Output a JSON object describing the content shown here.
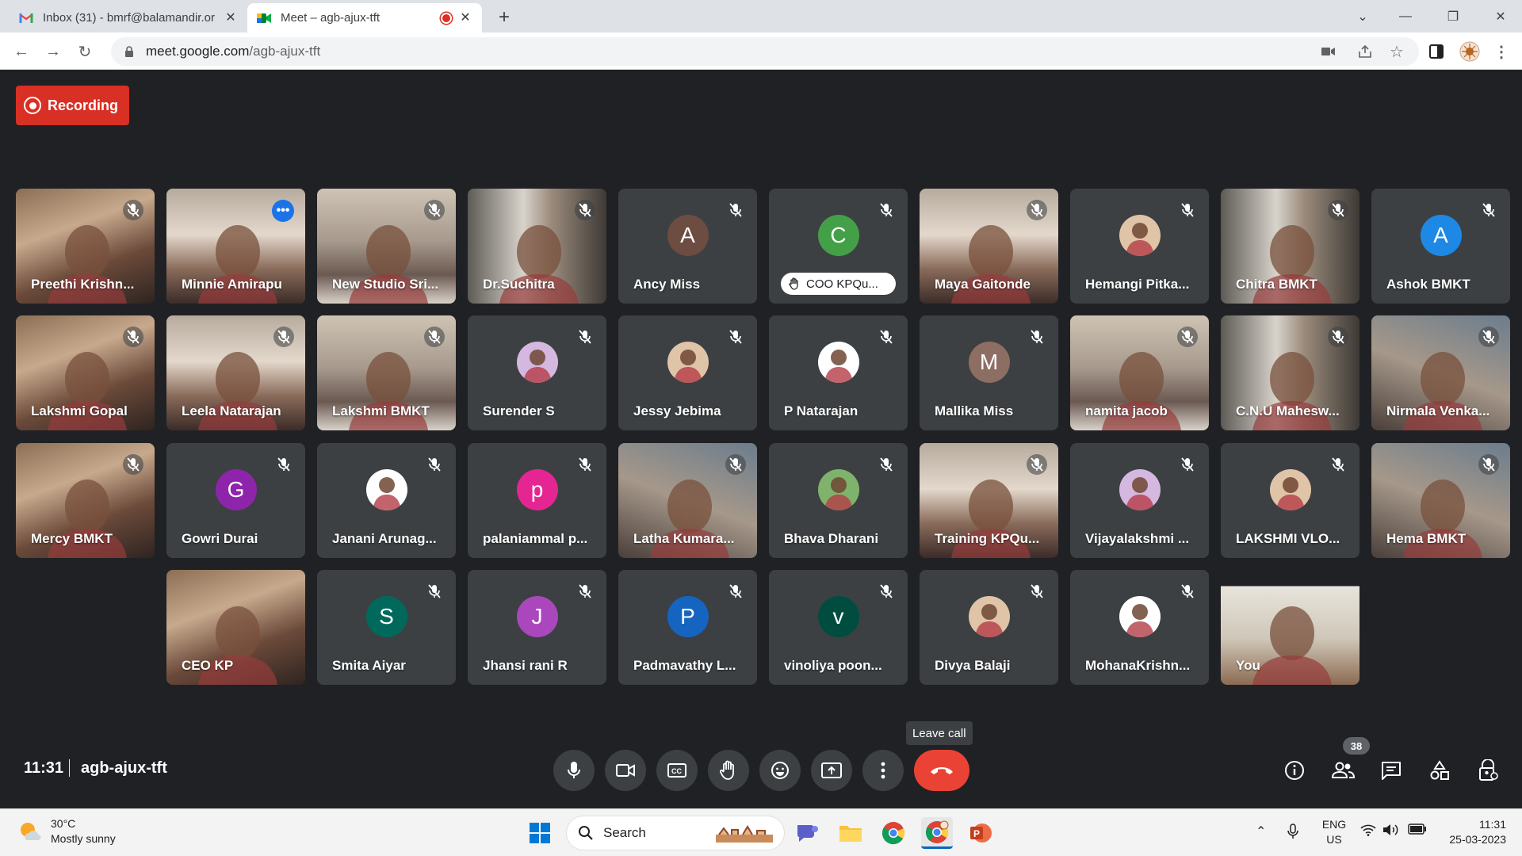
{
  "browser": {
    "tabs": [
      {
        "title": "Inbox (31) - bmrf@balamandir.or",
        "active": false,
        "favicon": "gmail-icon"
      },
      {
        "title": "Meet – agb-ajux-tft",
        "active": true,
        "favicon": "meet-icon"
      }
    ],
    "url_host": "meet.google.com",
    "url_path": "/agb-ajux-tft"
  },
  "meet": {
    "recording_label": "Recording",
    "time": "11:31",
    "meeting_code": "agb-ajux-tft",
    "leave_tooltip": "Leave call",
    "participant_count": "38",
    "participants": [
      {
        "name": "Preethi Krishn...",
        "kind": "video"
      },
      {
        "name": "Minnie Amirapu",
        "kind": "video",
        "speaking": true
      },
      {
        "name": "New Studio Sri...",
        "kind": "video"
      },
      {
        "name": "Dr.Suchitra",
        "kind": "video"
      },
      {
        "name": "Ancy Miss",
        "kind": "letter",
        "letter": "A",
        "color": "#6d4c41"
      },
      {
        "name": "COO KPQu...",
        "kind": "letter",
        "letter": "C",
        "color": "#43a047",
        "hand_raised": true
      },
      {
        "name": "Maya Gaitonde",
        "kind": "video"
      },
      {
        "name": "Hemangi Pitka...",
        "kind": "photo"
      },
      {
        "name": "Chitra BMKT",
        "kind": "video"
      },
      {
        "name": "Ashok BMKT",
        "kind": "letter",
        "letter": "A",
        "color": "#1e88e5"
      },
      {
        "name": "Lakshmi Gopal",
        "kind": "video"
      },
      {
        "name": "Leela Natarajan",
        "kind": "video"
      },
      {
        "name": "Lakshmi BMKT",
        "kind": "video"
      },
      {
        "name": "Surender S",
        "kind": "photo"
      },
      {
        "name": "Jessy Jebima",
        "kind": "photo"
      },
      {
        "name": "P Natarajan",
        "kind": "photo"
      },
      {
        "name": "Mallika Miss",
        "kind": "letter",
        "letter": "M",
        "color": "#8d6e63"
      },
      {
        "name": "namita jacob",
        "kind": "video"
      },
      {
        "name": "C.N.U Mahesw...",
        "kind": "video"
      },
      {
        "name": "Nirmala Venka...",
        "kind": "video"
      },
      {
        "name": "Mercy BMKT",
        "kind": "video"
      },
      {
        "name": "Gowri Durai",
        "kind": "letter",
        "letter": "G",
        "color": "#8e24aa"
      },
      {
        "name": "Janani Arunag...",
        "kind": "photo"
      },
      {
        "name": "palaniammal p...",
        "kind": "letter",
        "letter": "p",
        "color": "#e52592"
      },
      {
        "name": "Latha Kumara...",
        "kind": "video"
      },
      {
        "name": "Bhava Dharani",
        "kind": "photo"
      },
      {
        "name": "Training KPQu...",
        "kind": "video"
      },
      {
        "name": "Vijayalakshmi ...",
        "kind": "photo"
      },
      {
        "name": "LAKSHMI VLO...",
        "kind": "photo"
      },
      {
        "name": "Hema BMKT",
        "kind": "video"
      },
      {
        "name": "CEO KP",
        "kind": "video"
      },
      {
        "name": "Smita Aiyar",
        "kind": "letter",
        "letter": "S",
        "color": "#00695c"
      },
      {
        "name": "Jhansi rani R",
        "kind": "letter",
        "letter": "J",
        "color": "#ab47bc"
      },
      {
        "name": "Padmavathy L...",
        "kind": "letter",
        "letter": "P",
        "color": "#1565c0"
      },
      {
        "name": "vinoliya poon...",
        "kind": "letter",
        "letter": "v",
        "color": "#004d40"
      },
      {
        "name": "Divya Balaji",
        "kind": "photo"
      },
      {
        "name": "MohanaKrishn...",
        "kind": "photo"
      },
      {
        "name": "You",
        "kind": "video",
        "self": true
      }
    ]
  },
  "taskbar": {
    "temperature": "30°C",
    "weather": "Mostly sunny",
    "search_label": "Search",
    "lang_top": "ENG",
    "lang_bottom": "US",
    "clock_time": "11:31",
    "clock_date": "25-03-2023"
  }
}
